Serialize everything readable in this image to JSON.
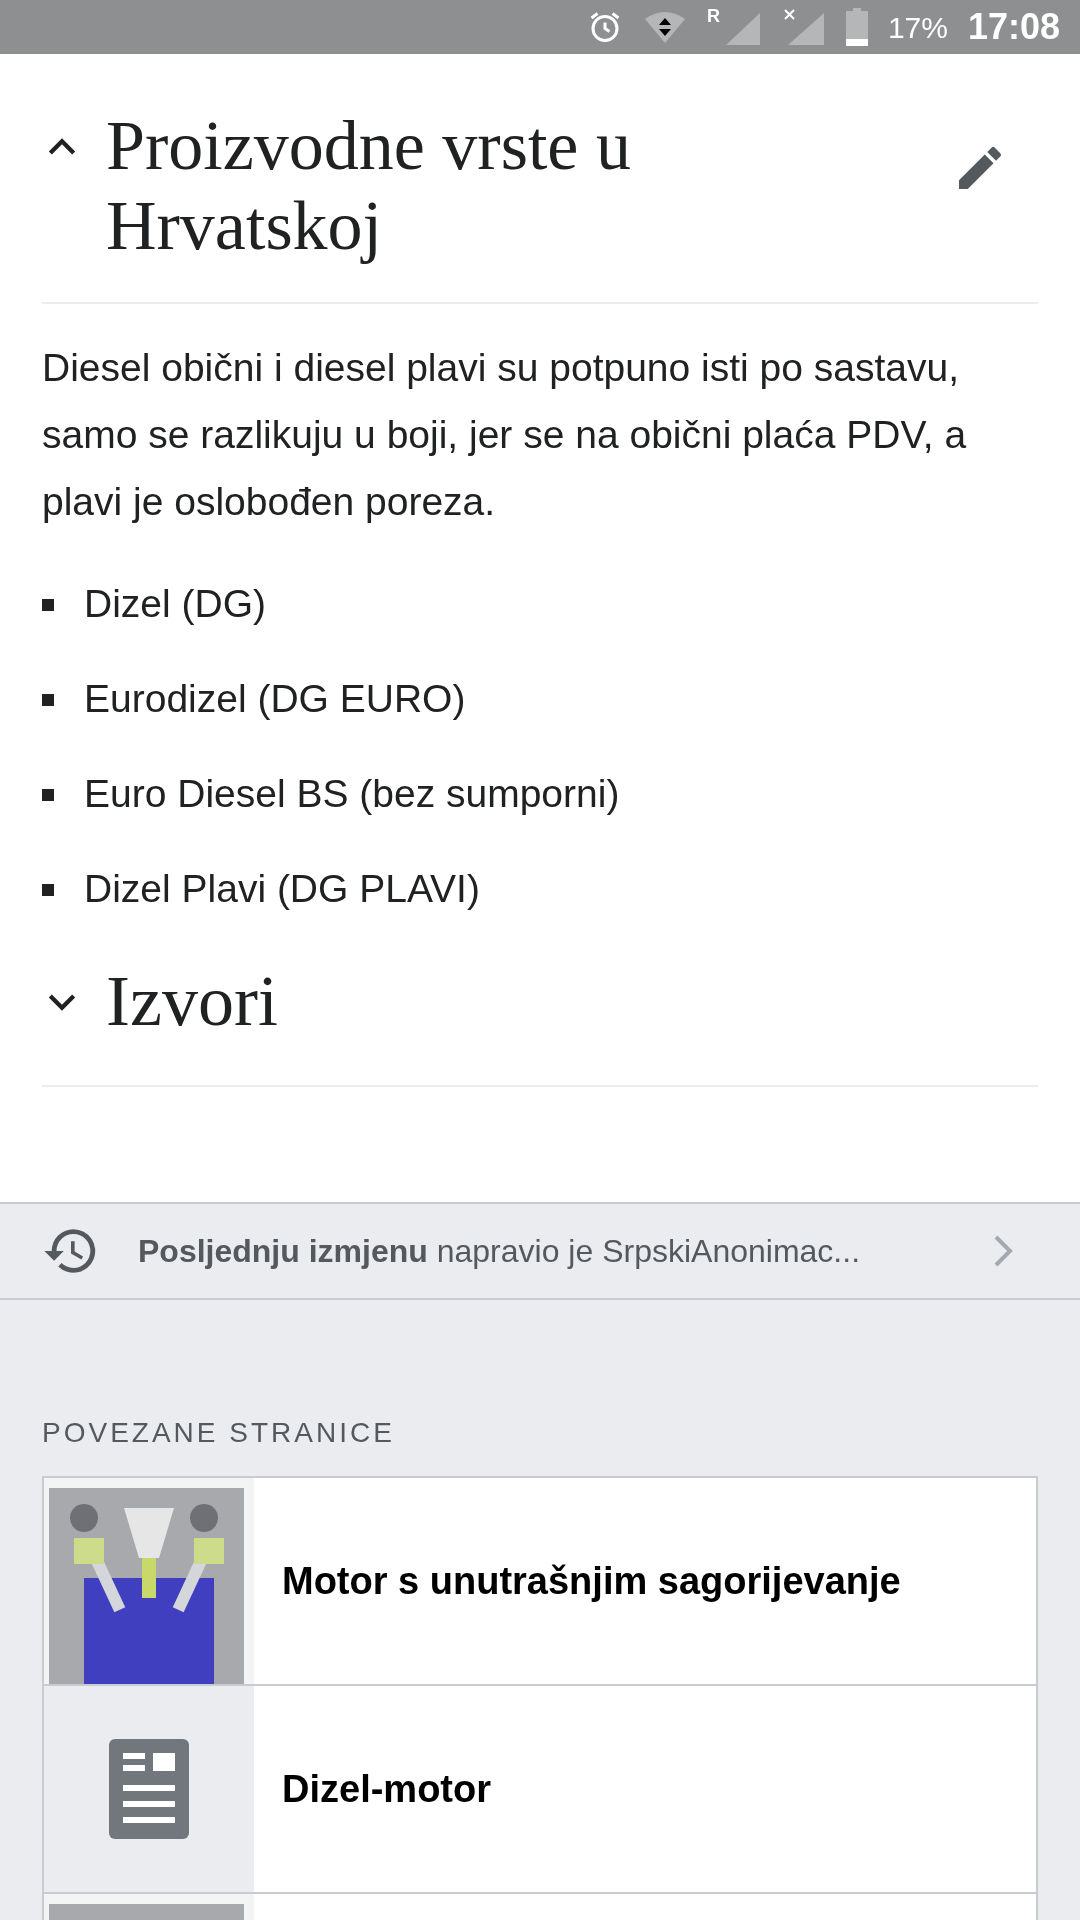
{
  "status_bar": {
    "roaming": "R",
    "battery": "17%",
    "time": "17:08"
  },
  "section": {
    "title": "Proizvodne vrste u Hrvatskoj",
    "expanded": true
  },
  "paragraph": "Diesel obični i diesel plavi su potpuno isti po sastavu, samo se razlikuju u boji, jer se na obični plaća PDV, a plavi je oslobođen poreza.",
  "bullets": [
    "Dizel (DG)",
    "Eurodizel (DG EURO)",
    "Euro Diesel BS (bez sumporni)",
    "Dizel Plavi (DG PLAVI)"
  ],
  "section_2": {
    "title": "Izvori",
    "expanded": false
  },
  "last_edit": "**Posljednju izmjenu** napravio je SrpskiAnonimac...",
  "related": {
    "heading": "POVEZANE STRANICE",
    "items": [
      {
        "kind": "picture",
        "title": "Motor s unutrašnjim sagorijevanje"
      },
      {
        "kind": "article",
        "title": "Dizel-motor"
      },
      {
        "kind": "picture"
      }
    ]
  }
}
